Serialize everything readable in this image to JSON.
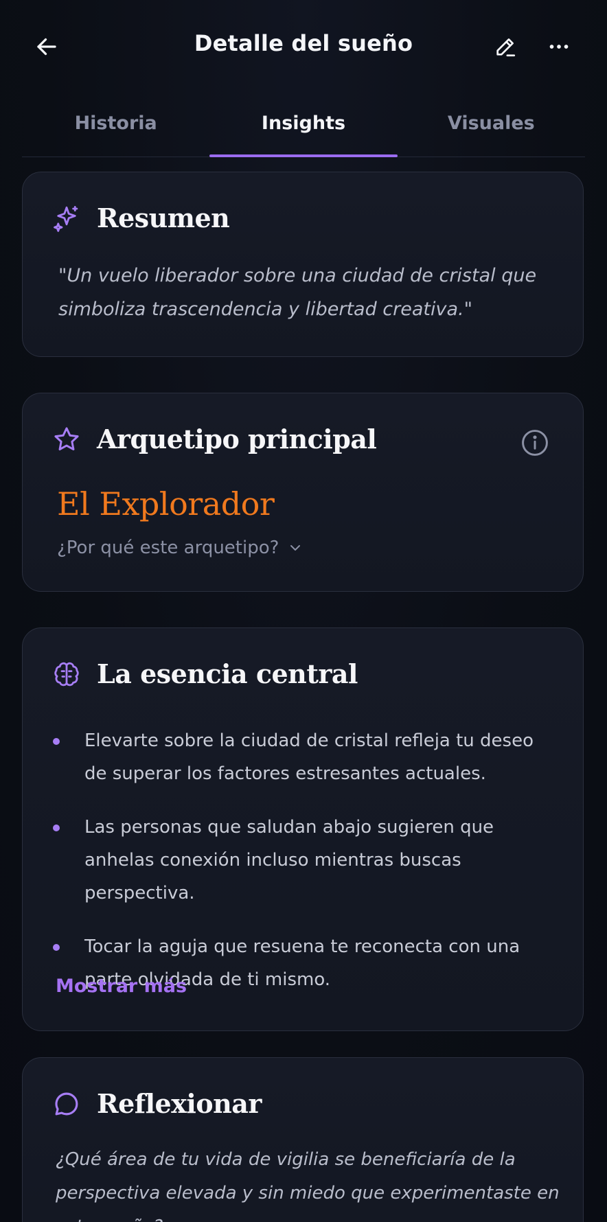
{
  "header": {
    "title": "Detalle del sueño",
    "back_icon": "arrow-left-icon",
    "edit_icon": "pencil-icon",
    "more_icon": "more-horizontal-icon"
  },
  "tabs": [
    {
      "label": "Historia",
      "active": false
    },
    {
      "label": "Insights",
      "active": true
    },
    {
      "label": "Visuales",
      "active": false
    }
  ],
  "resumen": {
    "title": "Resumen",
    "icon": "sparkle-icon",
    "text": "\"Un vuelo liberador sobre una ciudad de cristal que simboliza trascendencia y libertad creativa.\""
  },
  "arquetipo": {
    "title": "Arquetipo principal",
    "icon": "star-icon",
    "info_icon": "info-icon",
    "value": "El Explorador",
    "why_label": "¿Por qué este arquetipo?"
  },
  "esencia": {
    "title": "La esencia central",
    "icon": "brain-icon",
    "bullets": [
      "Elevarte sobre la ciudad de cristal refleja tu deseo de superar los factores estresantes actuales.",
      "Las personas que saludan abajo sugieren que anhelas conexión incluso mientras buscas perspectiva.",
      "Tocar la aguja que resuena te reconecta con una parte olvidada de ti mismo."
    ],
    "show_more": "Mostrar más"
  },
  "reflexionar": {
    "title": "Reflexionar",
    "icon": "chat-bubble-icon",
    "text": "¿Qué área de tu vida de vigilia se beneficiaría de la perspectiva elevada y sin miedo que experimentaste en este sueño?"
  },
  "colors": {
    "accent": "#9b6cf0",
    "archetype": "#f0791e",
    "background": "#0c0f17",
    "card": "#151924"
  }
}
